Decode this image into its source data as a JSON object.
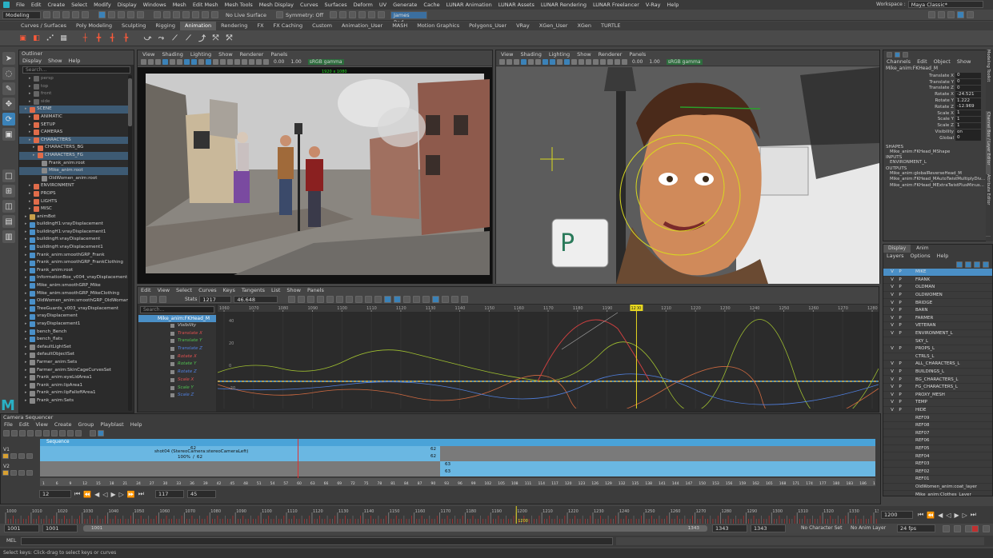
{
  "menubar": {
    "items": [
      "File",
      "Edit",
      "Create",
      "Select",
      "Modify",
      "Display",
      "Windows",
      "Mesh",
      "Edit Mesh",
      "Mesh Tools",
      "Mesh Display",
      "Curves",
      "Surfaces",
      "Deform",
      "UV",
      "Generate",
      "Cache",
      "LUNAR Animation",
      "LUNAR Assets",
      "LUNAR Rendering",
      "LUNAR Freelancer",
      "V-Ray",
      "Help"
    ],
    "workspace_label": "Workspace :",
    "workspace_value": "Maya Classic*"
  },
  "status": {
    "mode": "Modeling",
    "live_surface": "No Live Surface",
    "symmetry": "Symmetry: Off",
    "user": "James Rod..."
  },
  "shelf_tabs": [
    "Curves / Surfaces",
    "Poly Modeling",
    "Sculpting",
    "Rigging",
    "Animation",
    "Rendering",
    "FX",
    "FX Caching",
    "Custom",
    "Animation_User",
    "MASH",
    "Motion Graphics",
    "Polygons_User",
    "VRay",
    "XGen_User",
    "XGen",
    "TURTLE"
  ],
  "shelf_active": "Animation",
  "outliner": {
    "title": "Outliner",
    "menu": [
      "Display",
      "Show",
      "Help"
    ],
    "search_placeholder": "Search...",
    "items": [
      {
        "label": "persp",
        "indent": 2,
        "color": "#666",
        "dim": true
      },
      {
        "label": "top",
        "indent": 2,
        "color": "#666",
        "dim": true
      },
      {
        "label": "front",
        "indent": 2,
        "color": "#666",
        "dim": true
      },
      {
        "label": "side",
        "indent": 2,
        "color": "#666",
        "dim": true
      },
      {
        "label": "SCENE",
        "indent": 1,
        "color": "#e06c4a",
        "sel": true
      },
      {
        "label": "ANIMATIC",
        "indent": 2,
        "color": "#e06c4a"
      },
      {
        "label": "SETUP",
        "indent": 2,
        "color": "#e06c4a"
      },
      {
        "label": "CAMERAS",
        "indent": 2,
        "color": "#e06c4a"
      },
      {
        "label": "CHARACTERS",
        "indent": 2,
        "color": "#e06c4a",
        "sel": true
      },
      {
        "label": "CHARACTERS_BG",
        "indent": 3,
        "color": "#e06c4a"
      },
      {
        "label": "CHARACTERS_FG",
        "indent": 3,
        "color": "#e06c4a",
        "sel": true
      },
      {
        "label": "Frank_anim:root",
        "indent": 4,
        "color": "#8a8a8a"
      },
      {
        "label": "Mike_anim:root",
        "indent": 4,
        "color": "#8a8a8a",
        "sel": true
      },
      {
        "label": "OldWomen_anim:root",
        "indent": 4,
        "color": "#8a8a8a"
      },
      {
        "label": "ENVIRONMENT",
        "indent": 2,
        "color": "#e06c4a"
      },
      {
        "label": "PROPS",
        "indent": 2,
        "color": "#e06c4a"
      },
      {
        "label": "LIGHTS",
        "indent": 2,
        "color": "#e06c4a"
      },
      {
        "label": "MISC",
        "indent": 2,
        "color": "#e06c4a"
      },
      {
        "label": "animBot",
        "indent": 1,
        "color": "#c9a04a"
      },
      {
        "label": "buildingH1:vrayDisplacement",
        "indent": 1,
        "color": "#4a90c9"
      },
      {
        "label": "buildingH1:vrayDisplacement1",
        "indent": 1,
        "color": "#4a90c9"
      },
      {
        "label": "buildingH:vrayDisplacement",
        "indent": 1,
        "color": "#4a90c9"
      },
      {
        "label": "buildingH:vrayDisplacement1",
        "indent": 1,
        "color": "#4a90c9"
      },
      {
        "label": "Frank_anim:smoothGRP_Frank",
        "indent": 1,
        "color": "#4a90c9"
      },
      {
        "label": "Frank_anim:smoothGRP_FrankClothing",
        "indent": 1,
        "color": "#4a90c9"
      },
      {
        "label": "Frank_anim:root",
        "indent": 1,
        "color": "#4a90c9"
      },
      {
        "label": "InformationBox_v004_vrayDisplacement",
        "indent": 1,
        "color": "#4a90c9"
      },
      {
        "label": "Mike_anim:smoothGRP_Mike",
        "indent": 1,
        "color": "#4a90c9"
      },
      {
        "label": "Mike_anim:smoothGRP_MikeClothing",
        "indent": 1,
        "color": "#4a90c9"
      },
      {
        "label": "OldWomen_anim:smoothGRP_OldWoman",
        "indent": 1,
        "color": "#4a90c9"
      },
      {
        "label": "TreeGuards_v003_vrayDisplacement",
        "indent": 1,
        "color": "#4a90c9"
      },
      {
        "label": "vrayDisplacement",
        "indent": 1,
        "color": "#4a90c9"
      },
      {
        "label": "vrayDisplacement1",
        "indent": 1,
        "color": "#4a90c9"
      },
      {
        "label": "bench_Bench",
        "indent": 1,
        "color": "#4a90c9"
      },
      {
        "label": "bench_flats",
        "indent": 1,
        "color": "#4a90c9"
      },
      {
        "label": "defaultLightSet",
        "indent": 1,
        "color": "#888"
      },
      {
        "label": "defaultObjectSet",
        "indent": 1,
        "color": "#888"
      },
      {
        "label": "Farmer_anim:Sets",
        "indent": 1,
        "color": "#888"
      },
      {
        "label": "Farmer_anim:SkinCageCurvesSet",
        "indent": 1,
        "color": "#888"
      },
      {
        "label": "Frank_anim:eyeLidArea1",
        "indent": 1,
        "color": "#888"
      },
      {
        "label": "Frank_anim:lipArea1",
        "indent": 1,
        "color": "#888"
      },
      {
        "label": "Frank_anim:lipFalloffArea1",
        "indent": 1,
        "color": "#888"
      },
      {
        "label": "Frank_anim:Sets",
        "indent": 1,
        "color": "#888"
      }
    ]
  },
  "viewport_left": {
    "menu": [
      "View",
      "Shading",
      "Lighting",
      "Show",
      "Renderer",
      "Panels"
    ],
    "value_a": "0.00",
    "value_b": "1.00",
    "color_space": "sRGB gamma",
    "resolution": "1920 x 1080"
  },
  "viewport_right": {
    "menu": [
      "View",
      "Shading",
      "Lighting",
      "Show",
      "Renderer",
      "Panels"
    ],
    "value_a": "0.00",
    "value_b": "1.00",
    "color_space": "sRGB gamma"
  },
  "graph_editor": {
    "menu": [
      "Edit",
      "View",
      "Select",
      "Curves",
      "Keys",
      "Tangents",
      "List",
      "Show",
      "Panels"
    ],
    "stats_label": "Stats",
    "stats_frame": "1217",
    "stats_value": "46.648",
    "search_placeholder": "Search...",
    "node": "Mike_anim:FKHead_M",
    "channels": [
      {
        "label": "Visibility",
        "color": "#cfcfcf"
      },
      {
        "label": "Translate X",
        "color": "#e05050"
      },
      {
        "label": "Translate Y",
        "color": "#50c050"
      },
      {
        "label": "Translate Z",
        "color": "#5080e0"
      },
      {
        "label": "Rotate X",
        "color": "#e05050"
      },
      {
        "label": "Rotate Y",
        "color": "#50c050"
      },
      {
        "label": "Rotate Z",
        "color": "#5080e0"
      },
      {
        "label": "Scale X",
        "color": "#e05050"
      },
      {
        "label": "Scale Y",
        "color": "#50c050"
      },
      {
        "label": "Scale Z",
        "color": "#5080e0"
      }
    ],
    "ruler_ticks": [
      "1060",
      "1070",
      "1080",
      "1090",
      "1100",
      "1110",
      "1120",
      "1130",
      "1140",
      "1150",
      "1160",
      "1170",
      "1180",
      "1190",
      "1200",
      "1210",
      "1220",
      "1230",
      "1240",
      "1250",
      "1260",
      "1270",
      "1280"
    ],
    "current_frame": "1200",
    "y_ticks": [
      "40",
      "20",
      "0",
      "-20",
      "-40"
    ]
  },
  "channel_box": {
    "menu": [
      "Channels",
      "Edit",
      "Object",
      "Show"
    ],
    "node": "Mike_anim:FKHead_M",
    "attrs": [
      {
        "label": "Translate X",
        "value": "0"
      },
      {
        "label": "Translate Y",
        "value": "0"
      },
      {
        "label": "Translate Z",
        "value": "0"
      },
      {
        "label": "Rotate X",
        "value": "-24.521"
      },
      {
        "label": "Rotate Y",
        "value": "1.222"
      },
      {
        "label": "Rotate Z",
        "value": "-12.969"
      },
      {
        "label": "Scale X",
        "value": "1"
      },
      {
        "label": "Scale Y",
        "value": "1"
      },
      {
        "label": "Scale Z",
        "value": "1"
      },
      {
        "label": "Visibility",
        "value": "on"
      },
      {
        "label": "Global",
        "value": "0"
      }
    ],
    "shapes_header": "SHAPES",
    "shapes": [
      "Mike_anim:FKHead_MShape"
    ],
    "inputs_header": "INPUTS",
    "inputs": [
      "ENVIRONMENT_L"
    ],
    "outputs_header": "OUTPUTS",
    "outputs": [
      "Mike_anim:globalReverseHead_M",
      "Mike_anim:FKHead_MAutoTwistMultiplyDiv...",
      "Mike_anim:FKHead_MExtraTwistPlusMinus..."
    ]
  },
  "side_tabs": [
    "Modeling Toolkit",
    "Channel Box / Layer Editor",
    "Attribute Editor"
  ],
  "layer_editor": {
    "tabs": [
      "Display",
      "Anim"
    ],
    "menu": [
      "Layers",
      "Options",
      "Help"
    ],
    "layers": [
      {
        "v": "V",
        "p": "P",
        "name": "MIKE",
        "sel": true
      },
      {
        "v": "V",
        "p": "P",
        "name": "FRANK"
      },
      {
        "v": "V",
        "p": "P",
        "name": "OLDMAN"
      },
      {
        "v": "V",
        "p": "P",
        "name": "OLDWOMEN"
      },
      {
        "v": "V",
        "p": "P",
        "name": "BRIDGE"
      },
      {
        "v": "V",
        "p": "P",
        "name": "BARN"
      },
      {
        "v": "V",
        "p": "P",
        "name": "FARMER"
      },
      {
        "v": "V",
        "p": "P",
        "name": "VETERAN"
      },
      {
        "v": "V",
        "p": "P",
        "name": "ENVIRONMENT_L"
      },
      {
        "v": "",
        "p": "",
        "name": "SKY_L"
      },
      {
        "v": "V",
        "p": "P",
        "name": "PROPS_L"
      },
      {
        "v": "",
        "p": "",
        "name": "CTRLS_L"
      },
      {
        "v": "V",
        "p": "P",
        "name": "ALL_CHARACTERS_L"
      },
      {
        "v": "V",
        "p": "P",
        "name": "BUILDINGS_L"
      },
      {
        "v": "V",
        "p": "P",
        "name": "BG_CHARACTERS_L"
      },
      {
        "v": "V",
        "p": "P",
        "name": "FG_CHARACTERS_L"
      },
      {
        "v": "V",
        "p": "P",
        "name": "PROXY_MESH"
      },
      {
        "v": "V",
        "p": "P",
        "name": "TEMP"
      },
      {
        "v": "V",
        "p": "P",
        "name": "HIDE"
      },
      {
        "v": "",
        "p": "",
        "name": "REF09"
      },
      {
        "v": "",
        "p": "",
        "name": "REF08"
      },
      {
        "v": "",
        "p": "",
        "name": "REF07"
      },
      {
        "v": "",
        "p": "",
        "name": "REF06"
      },
      {
        "v": "",
        "p": "",
        "name": "REF05"
      },
      {
        "v": "",
        "p": "",
        "name": "REF04"
      },
      {
        "v": "",
        "p": "",
        "name": "REF03"
      },
      {
        "v": "",
        "p": "",
        "name": "REF02"
      },
      {
        "v": "",
        "p": "",
        "name": "REF01"
      },
      {
        "v": "",
        "p": "",
        "name": "OldWomen_anim:coat_layer"
      },
      {
        "v": "",
        "p": "",
        "name": "Mike_anim:Clothes_Layer"
      }
    ]
  },
  "camera_sequencer": {
    "title": "Camera Sequencer",
    "menu": [
      "File",
      "Edit",
      "View",
      "Create",
      "Group",
      "Playblast",
      "Help"
    ],
    "sequence_label": "Sequence",
    "track1": "V1",
    "track2": "V2",
    "shot_label": "shot04 (StereoCamera:stereoCameraLeft)",
    "shot_scale": "100%",
    "shot_slash": "/",
    "shot_frames": "62",
    "shot_start": "62",
    "shot_end_a": "62",
    "shot_end_b": "62",
    "clip2_a": "63",
    "clip2_b": "63",
    "ruler_ticks": [
      "1",
      "6",
      "9",
      "12",
      "15",
      "18",
      "21",
      "24",
      "27",
      "30",
      "33",
      "36",
      "39",
      "42",
      "45",
      "48",
      "51",
      "54",
      "57",
      "60",
      "63",
      "66",
      "69",
      "72",
      "75",
      "78",
      "81",
      "84",
      "87",
      "90",
      "93",
      "96",
      "99",
      "102",
      "105",
      "108",
      "111",
      "114",
      "117",
      "120",
      "123",
      "126",
      "129",
      "132",
      "135",
      "138",
      "141",
      "144",
      "147",
      "150",
      "153",
      "156",
      "159",
      "162",
      "165",
      "168",
      "171",
      "174",
      "177",
      "180",
      "183",
      "186",
      "189"
    ],
    "frame_field": "12",
    "field_a": "117",
    "field_b": "45"
  },
  "timeline": {
    "ticks": [
      "1000",
      "1010",
      "1020",
      "1030",
      "1040",
      "1050",
      "1060",
      "1070",
      "1080",
      "1090",
      "1100",
      "1110",
      "1120",
      "1130",
      "1140",
      "1150",
      "1160",
      "1170",
      "1180",
      "1190",
      "1200",
      "1210",
      "1220",
      "1230",
      "1240",
      "1250",
      "1260",
      "1270",
      "1280",
      "1290",
      "1300",
      "1310",
      "1320",
      "1330",
      "1340"
    ],
    "current": "1200",
    "current_field": "1200"
  },
  "range": {
    "start": "1001",
    "start2": "1001",
    "slider_start": "1001",
    "slider_end": "1343",
    "end": "1343",
    "end2": "1343",
    "character_set": "No Character Set",
    "anim_layer": "No Anim Layer",
    "fps": "24 fps"
  },
  "mel_label": "MEL",
  "help_text": "Select keys: Click-drag to select keys or curves"
}
